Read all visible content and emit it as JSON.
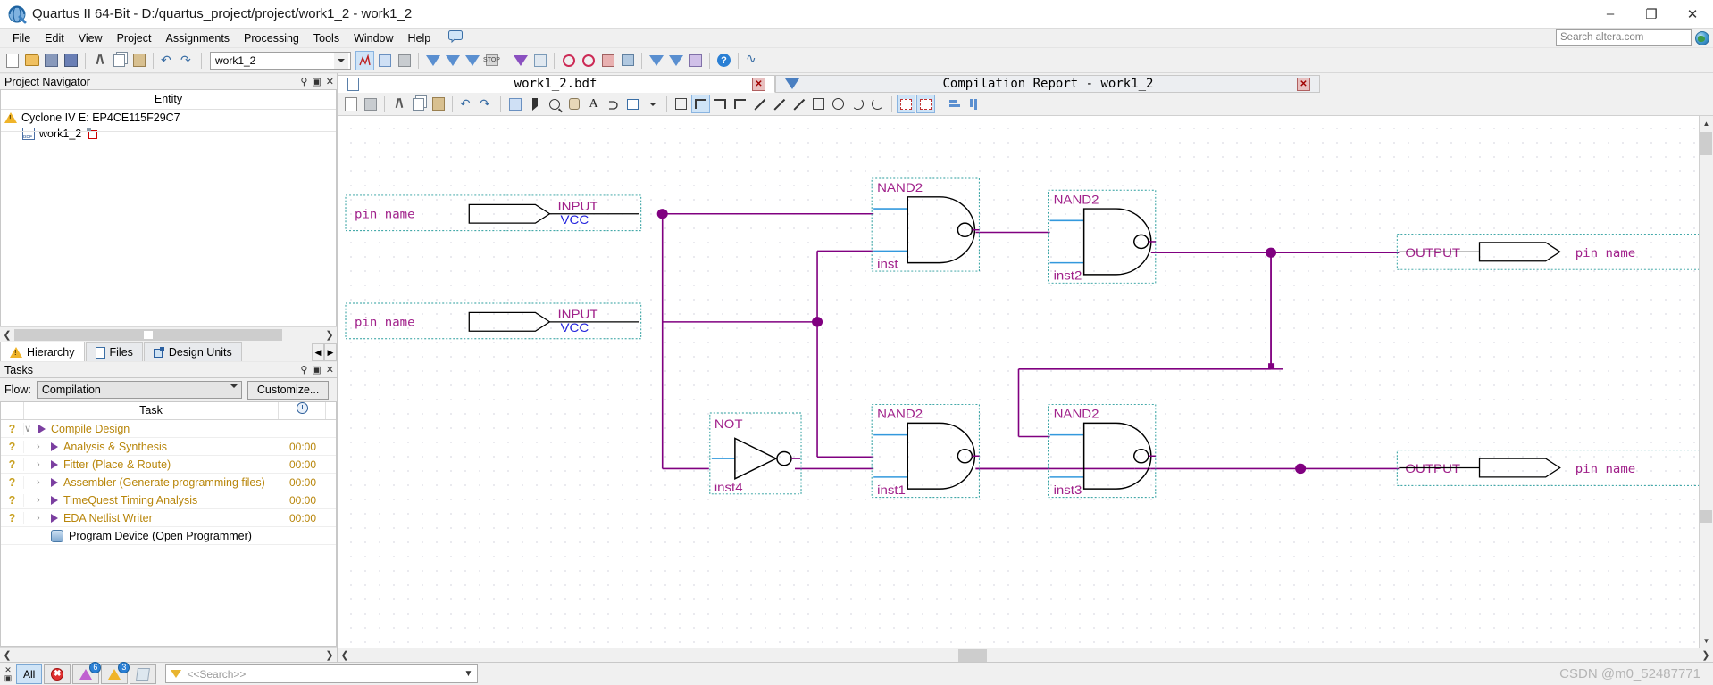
{
  "window": {
    "title": "Quartus II 64-Bit - D:/quartus_project/project/work1_2 - work1_2",
    "app_icon": "quartus-logo-icon",
    "minimize": "–",
    "maximize": "❐",
    "close": "✕"
  },
  "menubar": {
    "items": [
      "File",
      "Edit",
      "View",
      "Project",
      "Assignments",
      "Processing",
      "Tools",
      "Window",
      "Help"
    ],
    "search_placeholder": "Search altera.com",
    "globe_icon": "globe-icon"
  },
  "toolbar": {
    "project_combo_value": "work1_2",
    "icons": [
      "new-file-icon",
      "open-file-icon",
      "save-icon",
      "save-all-icon",
      "cut-icon",
      "copy-icon",
      "paste-icon",
      "undo-icon",
      "redo-icon"
    ]
  },
  "project_navigator": {
    "title": "Project Navigator",
    "pin_icon": "pin-icon",
    "float_icon": "float-icon",
    "close_icon": "close-icon",
    "column_header": "Entity",
    "device": "Cyclone IV E: EP4CE115F29C7",
    "device_icon": "warning-triangle-icon",
    "entity": "work1_2",
    "entity_icon": "bdf-file-icon",
    "entity_badge_icon": "top-level-icon",
    "tabs": [
      {
        "label": "Hierarchy",
        "icon": "warning-triangle-icon",
        "active": true
      },
      {
        "label": "Files",
        "icon": "files-icon",
        "active": false
      },
      {
        "label": "Design Units",
        "icon": "design-units-icon",
        "active": false
      }
    ]
  },
  "tasks": {
    "title": "Tasks",
    "pin_icon": "pin-icon",
    "float_icon": "float-icon",
    "close_icon": "close-icon",
    "flow_label": "Flow:",
    "flow_value": "Compilation",
    "customize_label": "Customize...",
    "col_task": "Task",
    "col_time_icon": "clock-icon",
    "rows": [
      {
        "status": "?",
        "label": "Compile Design",
        "time": "",
        "level": 0,
        "expander": "∨",
        "play": true
      },
      {
        "status": "?",
        "label": "Analysis & Synthesis",
        "time": "00:00",
        "level": 1,
        "expander": "›",
        "play": true
      },
      {
        "status": "?",
        "label": "Fitter (Place & Route)",
        "time": "00:00",
        "level": 1,
        "expander": "›",
        "play": true
      },
      {
        "status": "?",
        "label": "Assembler (Generate programming files)",
        "time": "00:00",
        "level": 1,
        "expander": "›",
        "play": true
      },
      {
        "status": "?",
        "label": "TimeQuest Timing Analysis",
        "time": "00:00",
        "level": 1,
        "expander": "›",
        "play": true
      },
      {
        "status": "?",
        "label": "EDA Netlist Writer",
        "time": "00:00",
        "level": 1,
        "expander": "›",
        "play": true
      },
      {
        "status": "",
        "label": "Program Device (Open Programmer)",
        "time": "",
        "level": 1,
        "expander": "",
        "play": false,
        "black": true
      }
    ]
  },
  "document_tabs": [
    {
      "label": "work1_2.bdf",
      "icon": "bdf-file-icon",
      "close_icon": "close-icon",
      "active": true
    },
    {
      "label": "Compilation Report - work1_2",
      "icon": "arrow-down-icon",
      "close_icon": "close-icon",
      "active": false
    }
  ],
  "schematic": {
    "input_pins": [
      {
        "pin_label": "pin name",
        "io_type": "INPUT",
        "default": "VCC"
      },
      {
        "pin_label": "pin name",
        "io_type": "INPUT",
        "default": "VCC"
      }
    ],
    "output_pins": [
      {
        "io_type": "OUTPUT",
        "pin_label": "pin name"
      },
      {
        "io_type": "OUTPUT",
        "pin_label": "pin name"
      }
    ],
    "gates": [
      {
        "type": "NAND2",
        "instance": "inst"
      },
      {
        "type": "NAND2",
        "instance": "inst2"
      },
      {
        "type": "NAND2",
        "instance": "inst3"
      },
      {
        "type": "NAND2",
        "instance": "inst1"
      },
      {
        "type": "NOT",
        "instance": "inst4"
      }
    ],
    "colors": {
      "wire": "#800080",
      "input_lead": "#3399dd",
      "label": "#a0208a",
      "vcc_label": "#2222dd",
      "selection_box": "#2a9d9d"
    }
  },
  "messages": {
    "close_icon": "close-icon",
    "all_label": "All",
    "filters": [
      {
        "name": "error-filter",
        "icon": "error-icon",
        "badge": ""
      },
      {
        "name": "critical-warning-filter",
        "icon": "critical-warning-icon",
        "badge": "6"
      },
      {
        "name": "warning-filter",
        "icon": "warning-icon",
        "badge": "3"
      },
      {
        "name": "info-filter",
        "icon": "info-icon",
        "badge": ""
      }
    ],
    "search_placeholder": "<<Search>>",
    "funnel_icon": "funnel-icon",
    "chevron_icon": "chevron-down-icon"
  },
  "watermark": "CSDN @m0_52487771"
}
